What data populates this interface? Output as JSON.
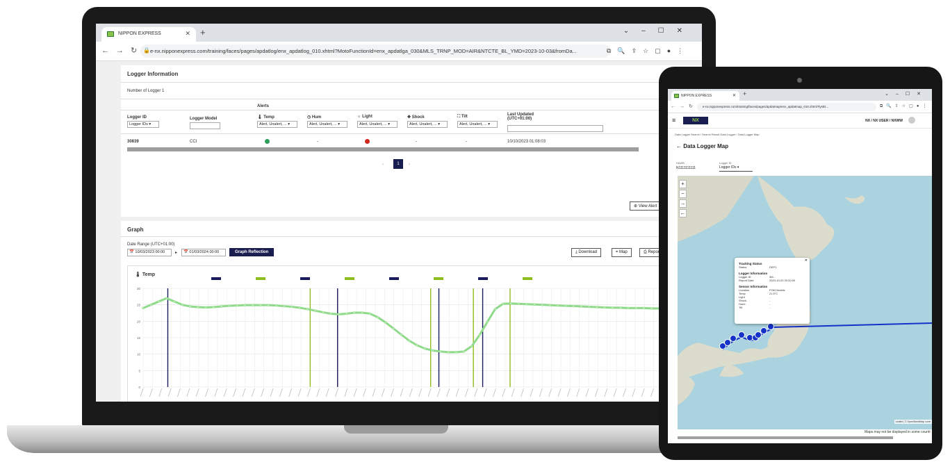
{
  "laptop": {
    "browser": {
      "tab_title": "NIPPON EXPRESS",
      "url": "e-nx.nipponexpress.com/training/faces/pages/apdatlog/enx_apdatlog_010.xhtml?MotoFunctionId=enx_apdatlga_030&MLS_TRNP_MOD=AIR&NTCTE_BL_YMD=2023-10-03&fromDa..."
    },
    "logger_info": {
      "title": "Logger Information",
      "count_text": "Number of Logger 1",
      "alerts_label": "Alerts",
      "columns": [
        "Logger ID",
        "Logger Model",
        "Temp",
        "Hum",
        "Light",
        "Shock",
        "Tilt",
        "Last Updated (UTC+01:00)"
      ],
      "filter_logger": "Logger IDs",
      "filter_alert": "Alert, Unalert, ...",
      "row": {
        "logger_id": "30839",
        "model": "CCI",
        "hum": "-",
        "shock": "-",
        "tilt": "-",
        "last_updated": "10/10/2023 01:08:03"
      },
      "page": "1",
      "view_alert": "View Alert"
    },
    "graph": {
      "title": "Graph",
      "date_range_label": "Date Range (UTC+01:00)",
      "date_from": "10/03/2023 00:00",
      "date_to": "01/03/2024 00:00",
      "reflection_btn": "Graph Reflection",
      "download_btn": "Download",
      "map_btn": "Map",
      "report_btn": "Report",
      "chart_title": "Temp"
    }
  },
  "chart_data": {
    "type": "line",
    "title": "Temp",
    "ylim": [
      0,
      30
    ],
    "yticks": [
      0,
      5,
      10,
      15,
      20,
      25,
      30
    ],
    "series": [
      {
        "values": [
          24,
          25,
          26,
          27,
          26,
          25,
          24.5,
          24.3,
          24.2,
          24.3,
          24.5,
          24.7,
          24.8,
          24.9,
          24.9,
          24.9,
          24.9,
          24.8,
          24.6,
          24.4,
          24.1,
          23.7,
          23.2,
          22.7,
          22.3,
          22.1,
          22.3,
          22.6,
          22.6,
          22.3,
          21.2,
          19.6,
          17.8,
          15.9,
          14.1,
          12.7,
          11.7,
          11.1,
          10.8,
          10.6,
          10.6,
          10.8,
          12.4,
          15.8,
          19.8,
          23.7,
          25.3,
          25.4,
          25.3,
          25.2,
          25.1,
          25.0,
          24.9,
          24.8,
          24.7,
          24.6,
          24.5,
          24.4,
          24.3,
          24.2,
          24.1,
          24.1,
          24.0,
          24.0,
          24.0,
          23.9,
          23.9,
          23.9,
          23.8,
          23.8,
          23.8
        ]
      }
    ],
    "event_lines": [
      {
        "color": "#1a1a5e"
      },
      {
        "color": "#8fbc1f"
      },
      {
        "color": "#1a1a5e"
      },
      {
        "color": "#8fbc1f"
      },
      {
        "color": "#1a1a5e"
      },
      {
        "color": "#8fbc1f"
      },
      {
        "color": "#1a1a5e"
      },
      {
        "color": "#8fbc1f"
      }
    ],
    "line_color": "#8fd98a"
  },
  "tablet": {
    "tab_title": "NIPPON EXPRESS",
    "url": "e-nx.nipponexpress.com/training/faces/pages/apdatmap/enx_apdatmap_010.xhtml?lysID...",
    "user": "NX / NX USER / NXWW",
    "breadcrumb": "Data Logger Search / Search Result Data Logger / Data Logger Map",
    "map_title": "Data Logger Map",
    "hawb_label": "HAWB",
    "hawb_value": "N1111111111",
    "logger_id_label": "Logger ID",
    "logger_id_value": "Logger IDs",
    "popup": {
      "tracking_header": "Tracking Status",
      "status_label": "Status",
      "status_value": "DEP1",
      "logger_header": "Logger Information",
      "logger_id_label": "Logger ID",
      "logger_id_value": "3M...",
      "report_label": "Report Date",
      "report_value": "2023-10-03 20:20:00",
      "sensor_header": "Sensor Information",
      "location_label": "Location",
      "location_value": "FOKCindelis",
      "temp_label": "Temp",
      "temp_value": "21.5°C",
      "light_label": "Light",
      "shock_label": "Shock",
      "hum_label": "Humi",
      "tilt_label": "Tilt",
      "empty_value": "-"
    },
    "attribution": "Leaflet | © OpenStreetMap contr",
    "footnote": "Maps may not be displayed in some countr"
  }
}
